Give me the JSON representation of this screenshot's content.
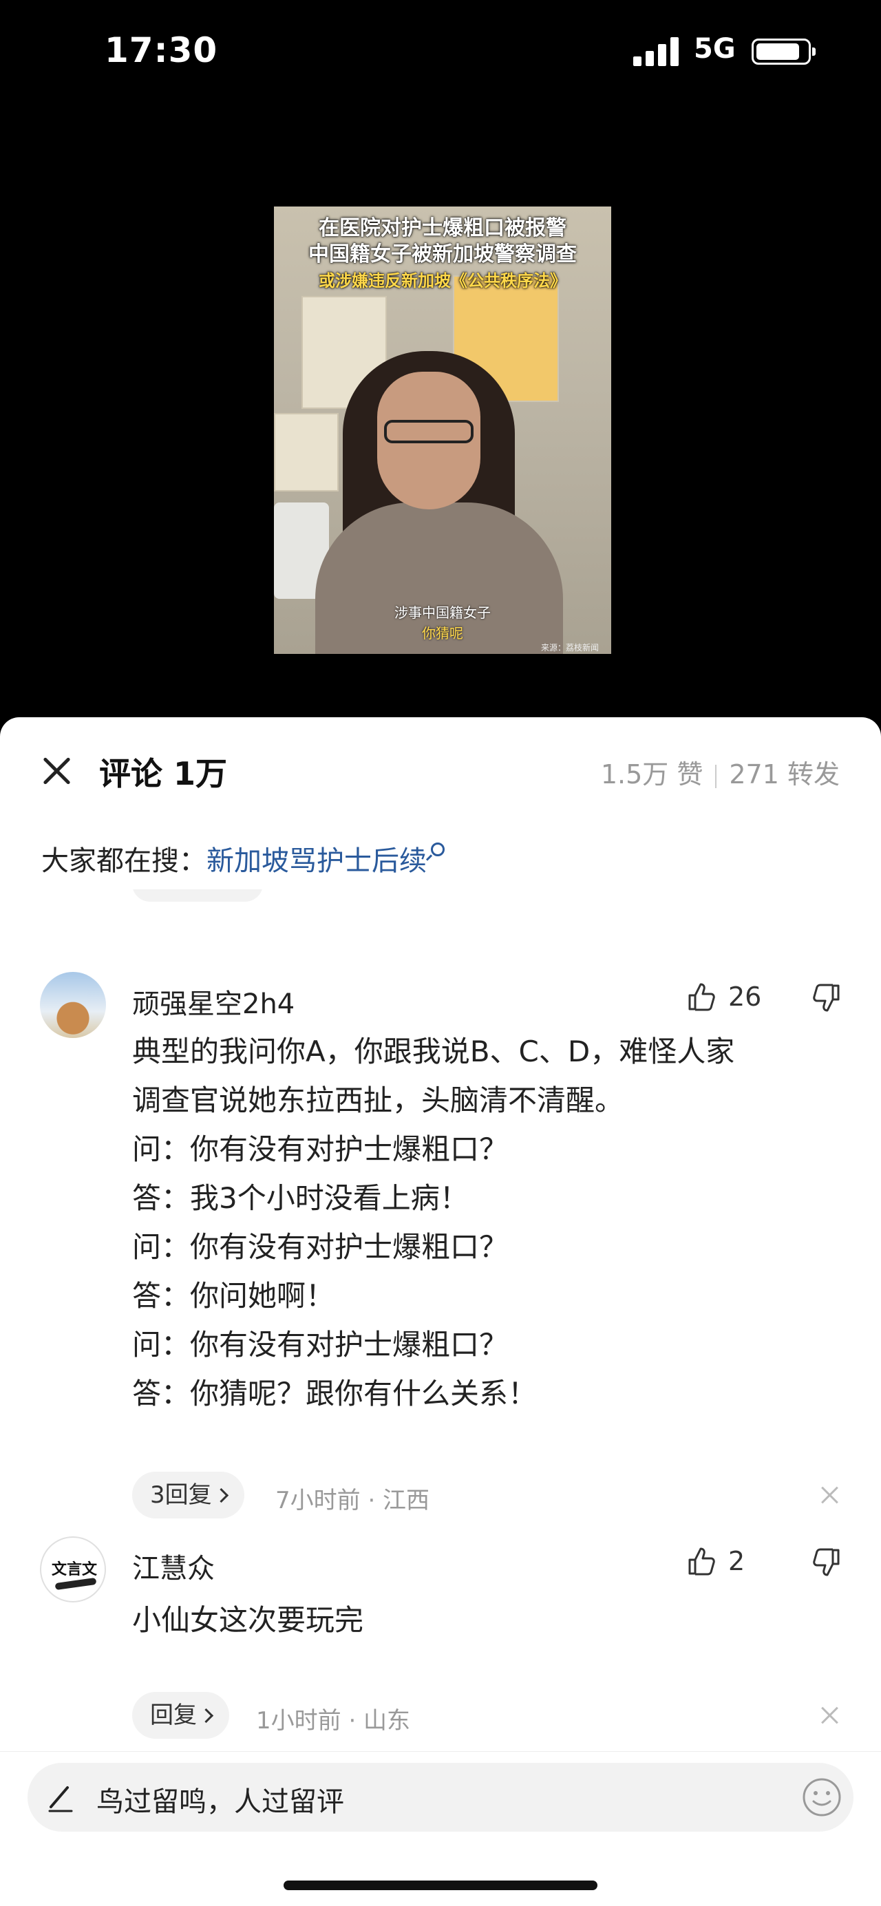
{
  "status_bar": {
    "time": "17:30",
    "network": "5G"
  },
  "video": {
    "title_line1": "在医院对护士爆粗口被报警",
    "title_line2": "中国籍女子被新加坡警察调查",
    "title_line3": "或涉嫌违反新加坡《公共秩序法》",
    "subtitle_line1": "涉事中国籍女子",
    "subtitle_line2": "你猜呢",
    "source": "来源：荔枝新闻"
  },
  "sheet": {
    "title": "评论 1万",
    "likes": "1.5万 赞",
    "shares": "271 转发",
    "search_prefix": "大家都在搜：",
    "search_keyword": "新加坡骂护士后续"
  },
  "comments": [
    {
      "username": "顽强星空2h4",
      "like_count": "26",
      "lines": [
        "典型的我问你A，你跟我说B、C、D，难怪人家",
        "调查官说她东拉西扯，头脑清不清醒。",
        "问：你有没有对护士爆粗口？",
        "答：我3个小时没看上病！",
        "问：你有没有对护士爆粗口？",
        "答：你问她啊！",
        "问：你有没有对护士爆粗口？",
        "答：你猜呢？跟你有什么关系！"
      ],
      "reply_label": "3回复",
      "meta": "7小时前 · 江西"
    },
    {
      "username": "江慧众",
      "like_count": "2",
      "avatar_text": "文言文",
      "lines": [
        "小仙女这次要玩完"
      ],
      "reply_label": "回复",
      "meta": "1小时前 · 山东"
    }
  ],
  "input": {
    "placeholder": "鸟过留鸣，人过留评"
  }
}
